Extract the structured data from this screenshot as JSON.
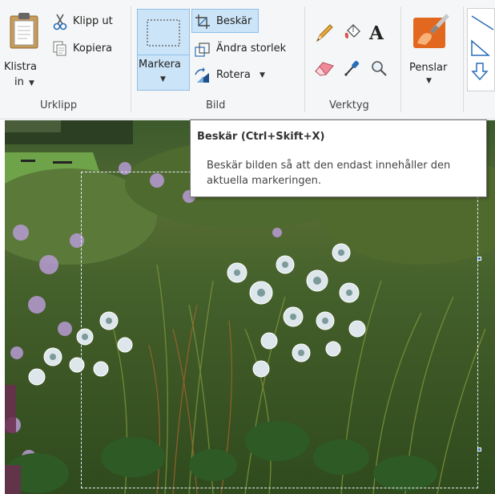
{
  "ribbon": {
    "clipboard": {
      "paste_label": "Klistra",
      "paste_label_line2": "in",
      "cut_label": "Klipp ut",
      "copy_label": "Kopiera",
      "group_label": "Urklipp"
    },
    "image": {
      "select_label": "Markera",
      "crop_label": "Beskär",
      "resize_label": "Ändra storlek",
      "rotate_label": "Rotera",
      "group_label": "Bild"
    },
    "tools": {
      "group_label": "Verktyg",
      "items": [
        "pencil-icon",
        "fill-icon",
        "text-icon",
        "eraser-icon",
        "color-picker-icon",
        "magnifier-icon"
      ]
    },
    "brushes": {
      "label": "Penslar"
    },
    "shapes": {
      "items": [
        "line-icon",
        "triangle-icon",
        "arrow-down-icon"
      ]
    }
  },
  "tooltip": {
    "title": "Beskär (Ctrl+Skift+X)",
    "body": "Beskär bilden så att den endast innehåller den aktuella markeringen."
  },
  "colors": {
    "ribbon_bg": "#f5f6f7",
    "selected_bg": "#cce4f7",
    "selected_border": "#8fbfe8",
    "accent_blue": "#2a6db5"
  }
}
